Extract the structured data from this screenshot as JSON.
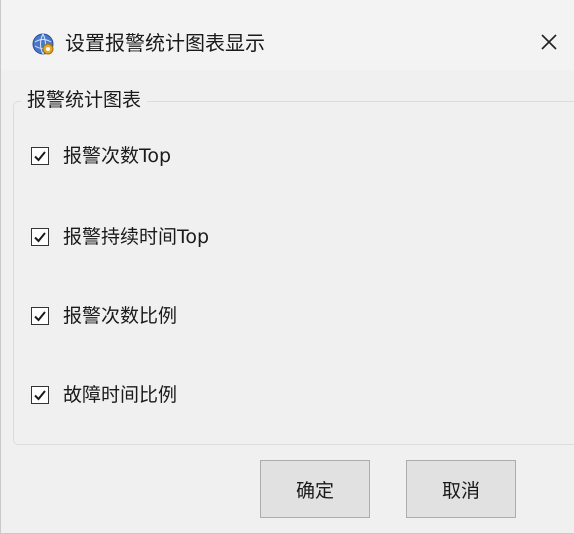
{
  "window": {
    "title": "设置报警统计图表显示",
    "close_symbol": "✕"
  },
  "group": {
    "title": "报警统计图表",
    "items": [
      {
        "label": "报警次数Top",
        "checked": true
      },
      {
        "label": "报警持续时间Top",
        "checked": true
      },
      {
        "label": "报警次数比例",
        "checked": true
      },
      {
        "label": "故障时间比例",
        "checked": true
      }
    ]
  },
  "buttons": {
    "ok_label": "确定",
    "cancel_label": "取消"
  },
  "icons": {
    "app": "globe-app-icon",
    "close": "close-icon",
    "check": "checkmark-icon"
  },
  "colors": {
    "window_bg": "#f0f0f0",
    "button_bg": "#e1e1e1",
    "button_border": "#adadad",
    "text": "#1a1a1a"
  }
}
